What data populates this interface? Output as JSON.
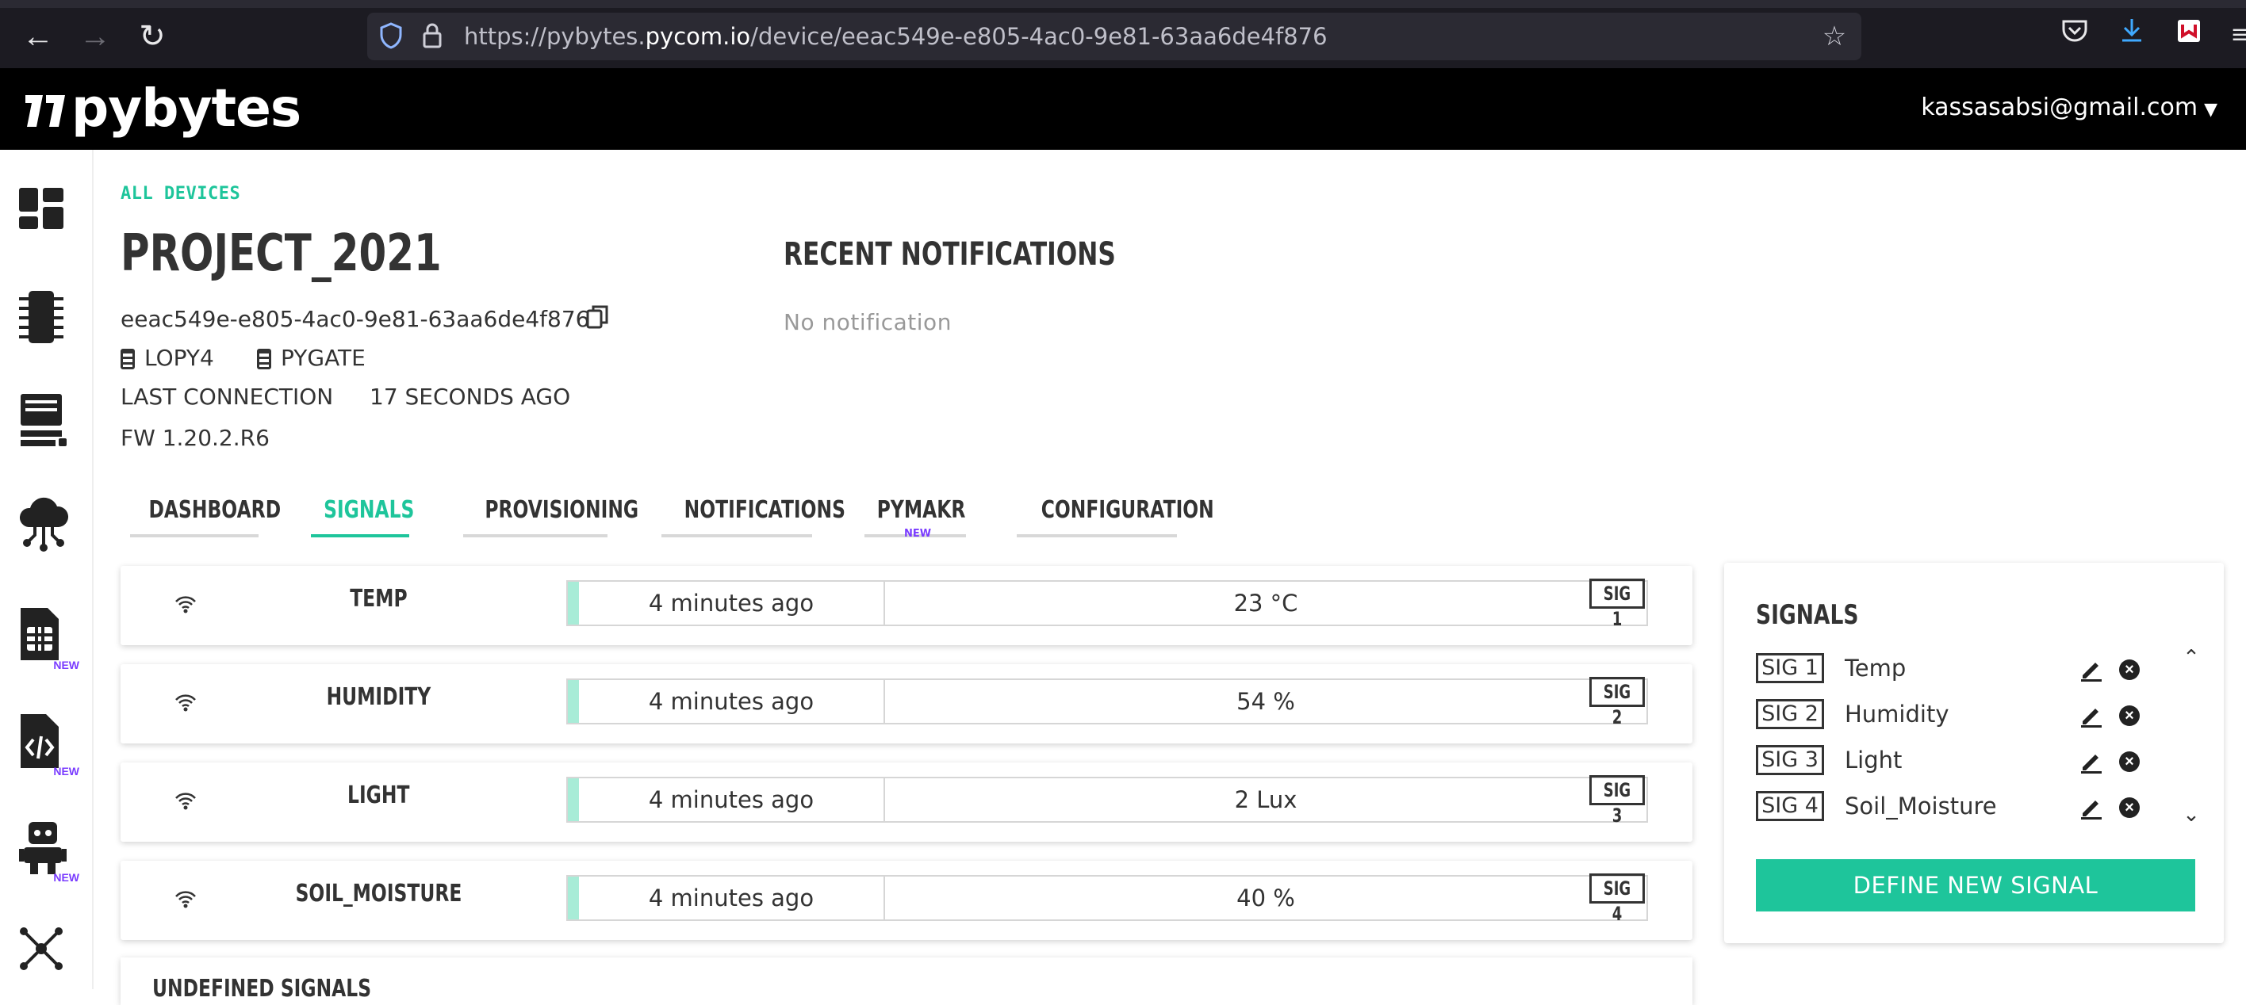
{
  "browser": {
    "url_prefix": "https://pybytes.",
    "url_domain": "pycom.io",
    "url_path": "/device/eeac549e-e805-4ac0-9e81-63aa6de4f876"
  },
  "header": {
    "logo_text": "pybytes",
    "user_email": "kassasabsi@gmail.com"
  },
  "sidebar": {
    "items": [
      {
        "icon": "dashboard-icon"
      },
      {
        "icon": "devices-chip-icon"
      },
      {
        "icon": "computer-icon"
      },
      {
        "icon": "cloud-network-icon"
      },
      {
        "icon": "sim-card-icon",
        "badge": "NEW"
      },
      {
        "icon": "code-file-icon",
        "badge": "NEW"
      },
      {
        "icon": "robot-icon",
        "badge": "NEW"
      },
      {
        "icon": "network-graph-icon"
      }
    ]
  },
  "breadcrumb": "ALL DEVICES",
  "device": {
    "name": "PROJECT_2021",
    "id": "eeac549e-e805-4ac0-9e81-63aa6de4f876",
    "hardware": [
      "LOPY4",
      "PYGATE"
    ],
    "last_connection_label": "LAST CONNECTION",
    "last_connection_value": "17 SECONDS AGO",
    "firmware": "FW 1.20.2.R6"
  },
  "notifications": {
    "title": "RECENT NOTIFICATIONS",
    "empty_text": "No notification"
  },
  "tabs": [
    {
      "label": "DASHBOARD"
    },
    {
      "label": "SIGNALS",
      "active": true
    },
    {
      "label": "PROVISIONING"
    },
    {
      "label": "NOTIFICATIONS"
    },
    {
      "label": "PYMAKR",
      "badge": "NEW"
    },
    {
      "label": "CONFIGURATION"
    }
  ],
  "signals": [
    {
      "name": "TEMP",
      "time": "4 minutes ago",
      "value": "23 °C",
      "tag": "SIG 1"
    },
    {
      "name": "HUMIDITY",
      "time": "4 minutes ago",
      "value": "54 %",
      "tag": "SIG 2"
    },
    {
      "name": "LIGHT",
      "time": "4 minutes ago",
      "value": "2 Lux",
      "tag": "SIG 3"
    },
    {
      "name": "SOIL_MOISTURE",
      "time": "4 minutes ago",
      "value": "40 %",
      "tag": "SIG 4"
    }
  ],
  "undefined_signals_title": "UNDEFINED SIGNALS",
  "signals_panel": {
    "title": "SIGNALS",
    "items": [
      {
        "tag": "SIG 1",
        "name": "Temp"
      },
      {
        "tag": "SIG 2",
        "name": "Humidity"
      },
      {
        "tag": "SIG 3",
        "name": "Light"
      },
      {
        "tag": "SIG 4",
        "name": "Soil_Moisture"
      }
    ],
    "define_button": "DEFINE NEW SIGNAL"
  },
  "colors": {
    "accent": "#1ec59b",
    "new_badge": "#7a3cff",
    "header_bg": "#000000"
  }
}
